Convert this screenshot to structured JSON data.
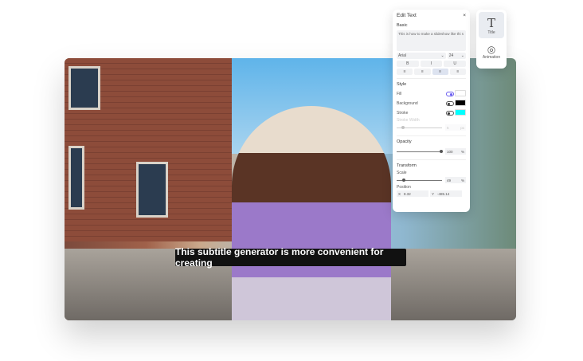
{
  "subtitle": "This subtitle generator is more convenient for creating",
  "panel": {
    "title": "Edit Text",
    "close": "×",
    "basic": "Basic",
    "text": "This is how to make a slideshow like thi s",
    "font": "Arial",
    "size": "24",
    "bold": "B",
    "italic": "I",
    "underline": "U",
    "style": "Style",
    "fill": "Fill",
    "background": "Background",
    "stroke": "Stroke",
    "stroke_width": "Stroke Width",
    "stroke_width_value": "5",
    "stroke_unit": "px",
    "opacity": "Opacity",
    "opacity_value": "100",
    "pct": "%",
    "transform": "Transform",
    "scale": "Scale",
    "scale_value": "49",
    "position": "Position",
    "x_label": "X",
    "x_value": "8.32",
    "y_label": "Y",
    "y_value": "-485.14"
  },
  "tools": {
    "title": "Title",
    "animation": "Animation"
  },
  "colors": {
    "fill": "#ffffff",
    "background": "#000000",
    "stroke": "#00ffff"
  }
}
